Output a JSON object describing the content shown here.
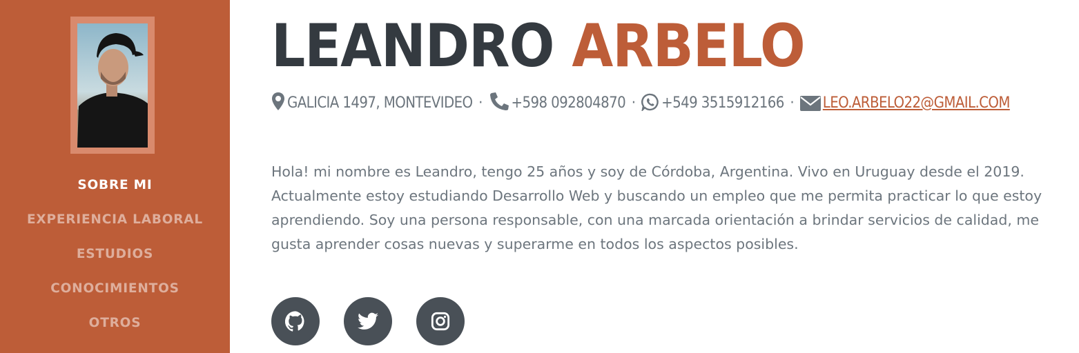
{
  "colors": {
    "primary": "#bd5d38",
    "dark": "#343a40",
    "muted": "#6c757d",
    "social_bg": "#495057"
  },
  "sidebar": {
    "nav": [
      {
        "label": "SOBRE MI",
        "active": true
      },
      {
        "label": "EXPERIENCIA LABORAL",
        "active": false
      },
      {
        "label": "ESTUDIOS",
        "active": false
      },
      {
        "label": "CONOCIMIENTOS",
        "active": false
      },
      {
        "label": "OTROS",
        "active": false
      }
    ]
  },
  "header": {
    "first_name": "LEANDRO",
    "last_name": "ARBELO"
  },
  "contact": {
    "address": "GALICIA 1497, MONTEVIDEO",
    "phone": "+598 092804870",
    "whatsapp": "+549 3515912166",
    "email": "LEO.ARBELO22@GMAIL.COM",
    "separator": "·",
    "icons": [
      "map-marker-icon",
      "phone-icon",
      "whatsapp-icon",
      "envelope-icon"
    ]
  },
  "bio": "Hola! mi nombre es Leandro, tengo 25 años y soy de Córdoba, Argentina. Vivo en Uruguay desde el 2019. Actualmente estoy estudiando Desarrollo Web y buscando un empleo que me permita practicar lo que estoy aprendiendo. Soy una persona responsable, con una marcada orientación a brindar servicios de calidad, me gusta aprender cosas nuevas y superarme en todos los aspectos posibles.",
  "social": [
    "github-icon",
    "twitter-icon",
    "instagram-icon"
  ]
}
